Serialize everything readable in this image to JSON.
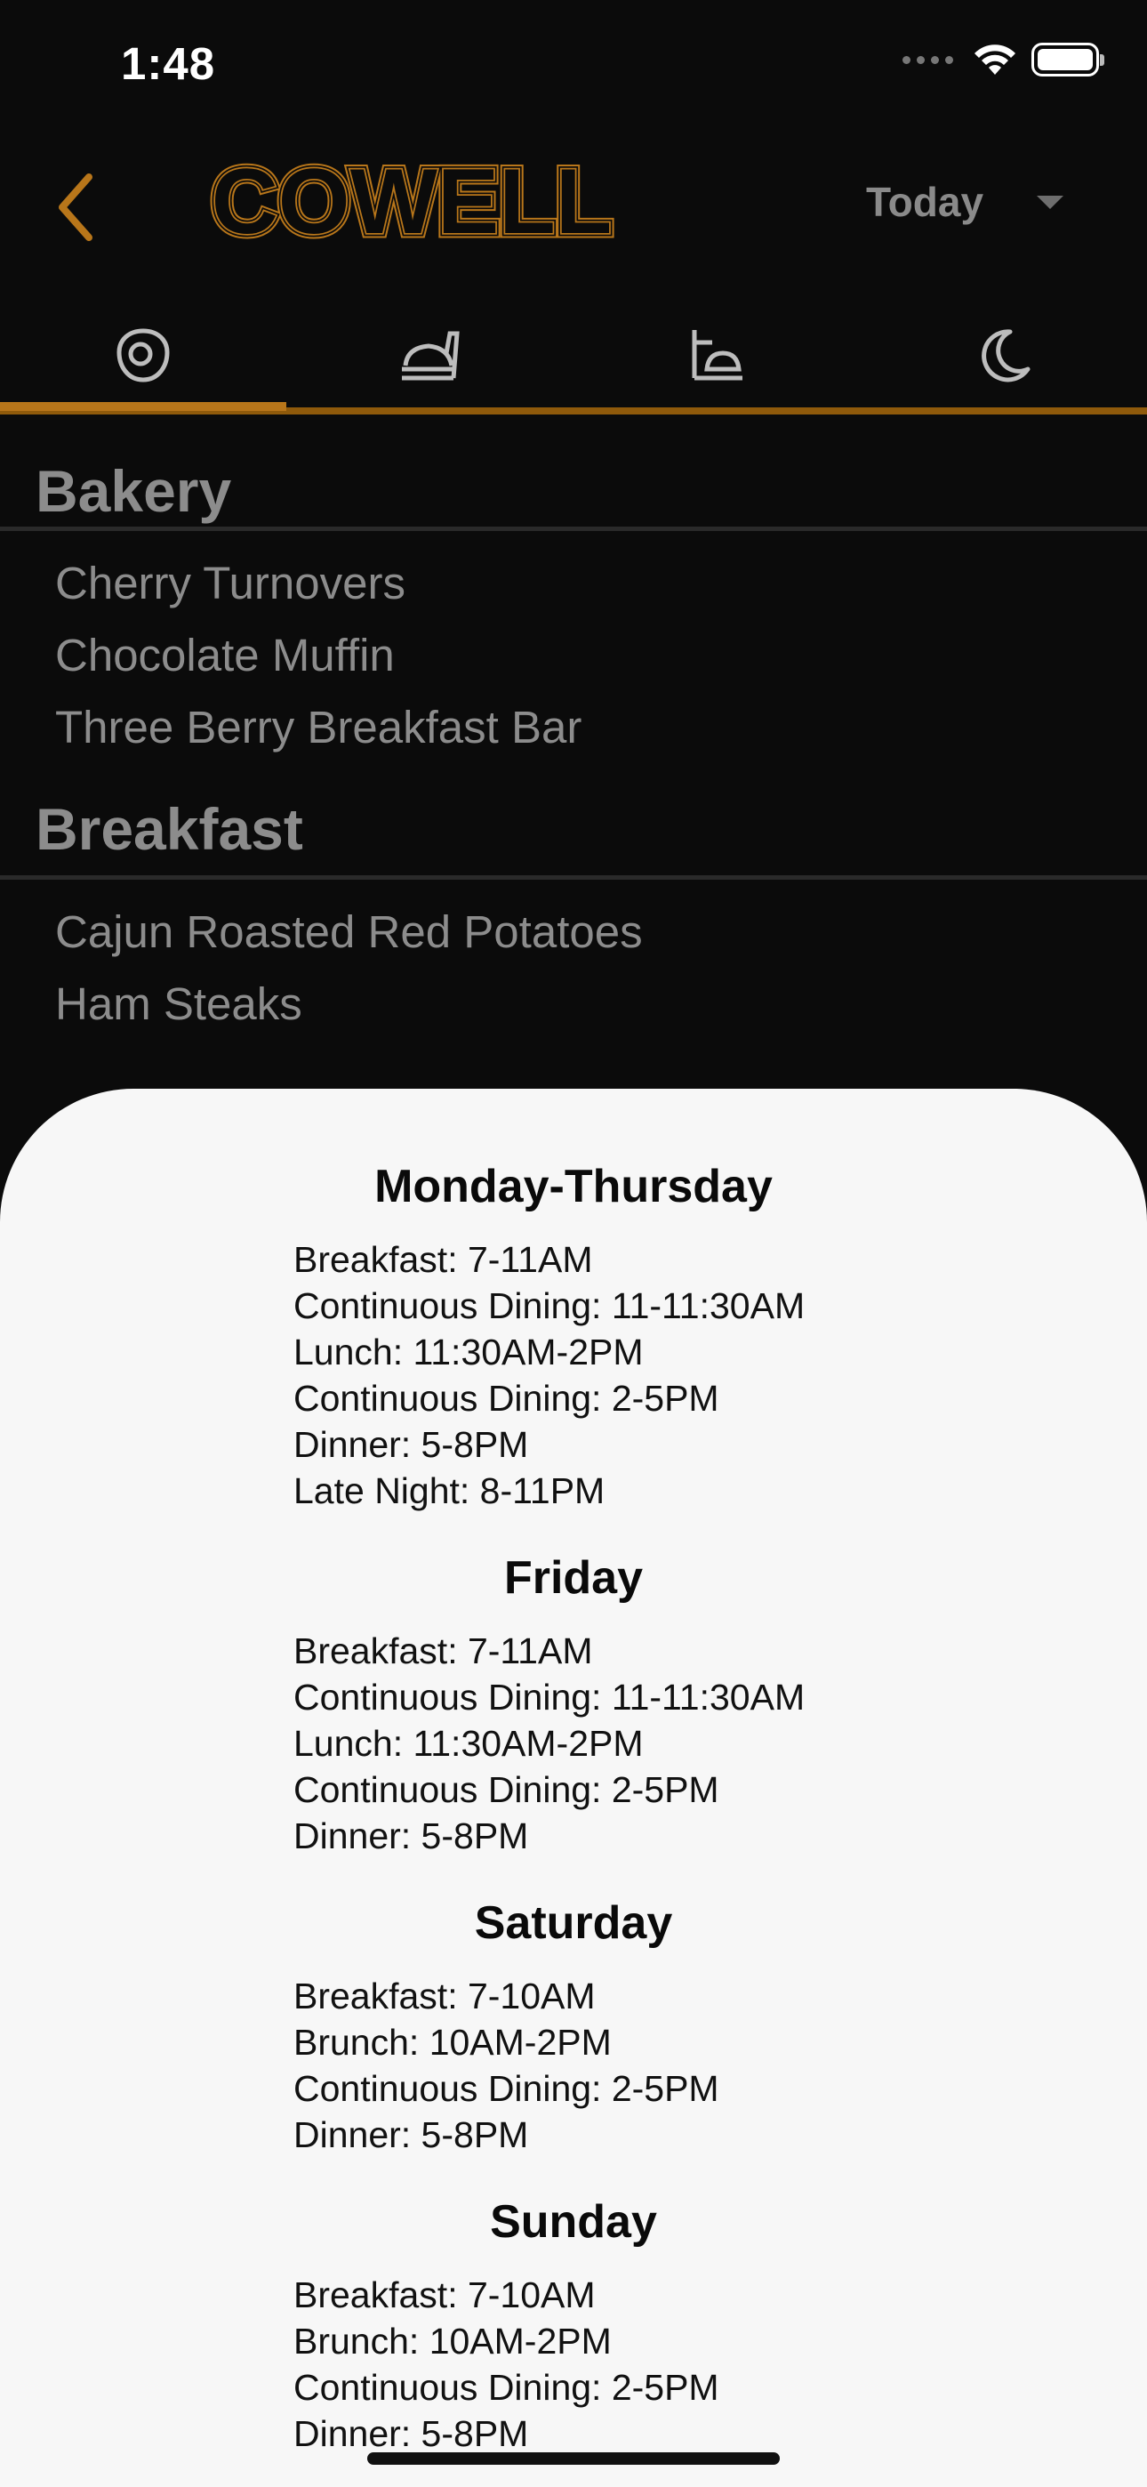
{
  "status_bar": {
    "time": "1:48"
  },
  "header": {
    "logo_text": "COWELL",
    "day_selector": "Today",
    "brand_color": "#b8761a"
  },
  "tabs": [
    {
      "icon": "breakfast-egg-icon",
      "active": true
    },
    {
      "icon": "lunch-tray-icon",
      "active": false
    },
    {
      "icon": "dinner-plate-icon",
      "active": false
    },
    {
      "icon": "late-night-moon-icon",
      "active": false
    }
  ],
  "menu": {
    "categories": [
      {
        "title": "Bakery",
        "items": [
          "Cherry Turnovers",
          "Chocolate Muffin",
          "Three Berry Breakfast Bar"
        ]
      },
      {
        "title": "Breakfast",
        "items": [
          "Cajun Roasted Red Potatoes",
          "Ham Steaks"
        ]
      }
    ]
  },
  "hours_sheet": {
    "days": [
      {
        "title": "Monday-Thursday",
        "hours": [
          "Breakfast: 7-11AM",
          "Continuous Dining: 11-11:30AM",
          "Lunch: 11:30AM-2PM",
          "Continuous Dining: 2-5PM",
          "Dinner: 5-8PM",
          "Late Night: 8-11PM"
        ]
      },
      {
        "title": "Friday",
        "hours": [
          "Breakfast: 7-11AM",
          "Continuous Dining: 11-11:30AM",
          "Lunch: 11:30AM-2PM",
          "Continuous Dining: 2-5PM",
          "Dinner: 5-8PM"
        ]
      },
      {
        "title": "Saturday",
        "hours": [
          "Breakfast: 7-10AM",
          "Brunch: 10AM-2PM",
          "Continuous Dining: 2-5PM",
          "Dinner: 5-8PM"
        ]
      },
      {
        "title": "Sunday",
        "hours": [
          "Breakfast: 7-10AM",
          "Brunch: 10AM-2PM",
          "Continuous Dining: 2-5PM",
          "Dinner: 5-8PM"
        ]
      }
    ]
  }
}
